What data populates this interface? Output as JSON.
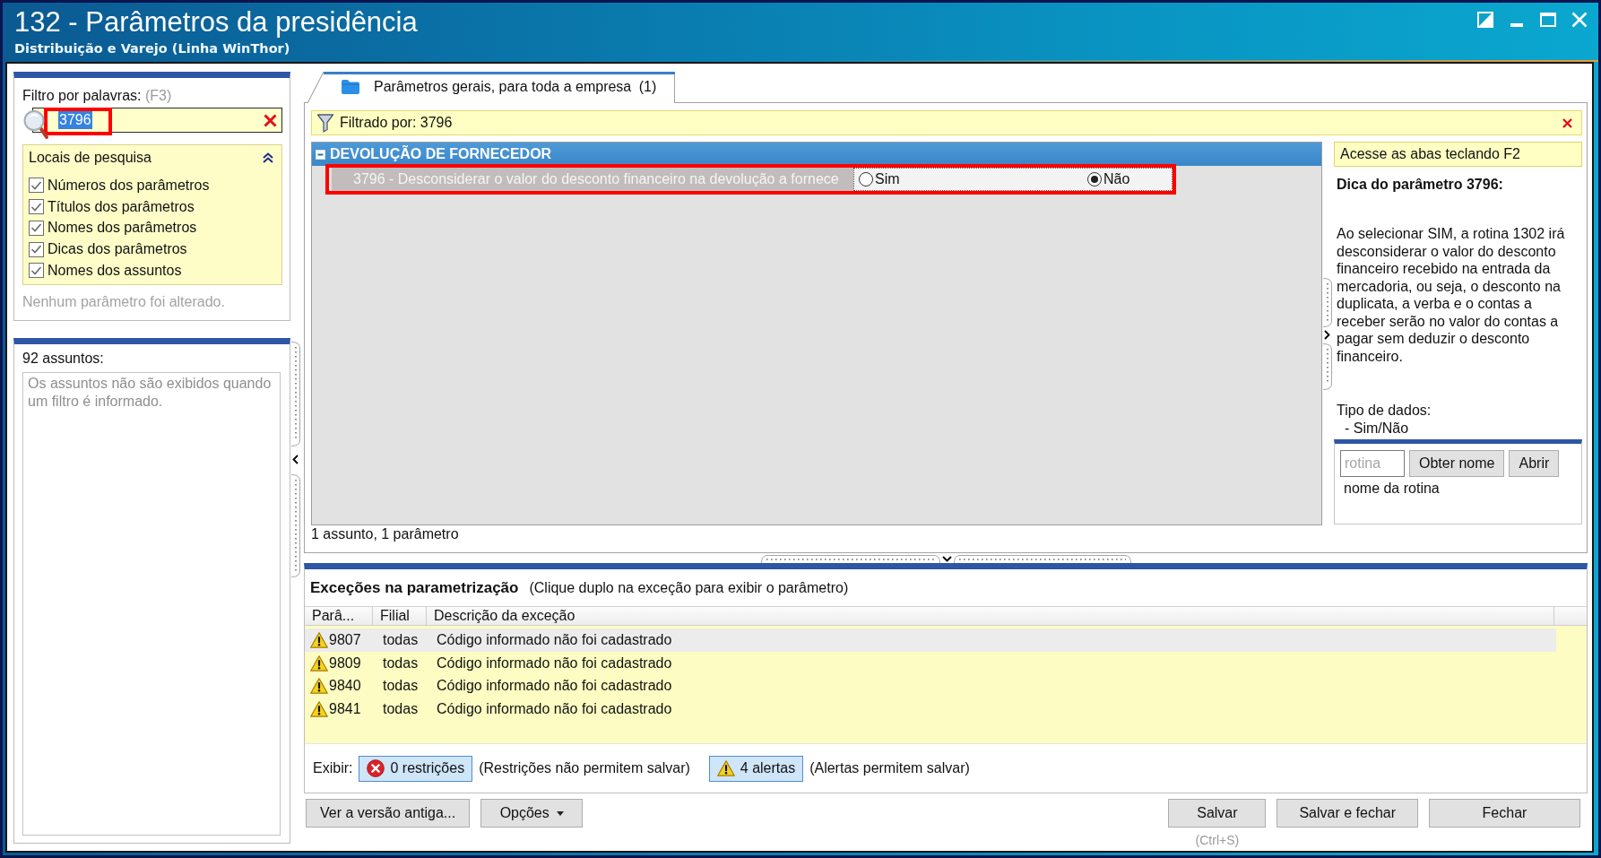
{
  "window": {
    "title": "132 - Parâmetros da presidência",
    "subtitle": "Distribuição e Varejo (Linha WinThor)"
  },
  "filter_panel": {
    "label": "Filtro por palavras:",
    "shortcut": "(F3)",
    "search": {
      "value": "3796",
      "text_selected": true,
      "highlighted": true
    },
    "search_locations": {
      "title": "Locais de pesquisa",
      "expanded": true,
      "options": [
        {
          "label": "Números dos parâmetros",
          "checked": true
        },
        {
          "label": "Títulos dos parâmetros",
          "checked": true
        },
        {
          "label": "Nomes dos parâmetros",
          "checked": true
        },
        {
          "label": "Dicas dos parâmetros",
          "checked": true
        },
        {
          "label": "Nomes dos assuntos",
          "checked": true
        }
      ]
    },
    "status": "Nenhum parâmetro foi alterado."
  },
  "subjects_panel": {
    "count": "92 assuntos:",
    "message": "Os assuntos não são exibidos quando um filtro é informado."
  },
  "tabs": [
    {
      "label": "Parâmetros gerais, para toda a empresa",
      "count": "(1)",
      "selected": true
    }
  ],
  "filter_bar": {
    "label": "Filtrado por: 3796"
  },
  "parameter_groups": [
    {
      "title": "DEVOLUÇÃO DE FORNECEDOR",
      "expanded": true,
      "parameters": [
        {
          "label": "3796 - Desconsiderar o valor do desconto financeiro na devolução a fornece",
          "highlighted": true,
          "options": [
            {
              "label": "Sim",
              "selected": false
            },
            {
              "label": "Não",
              "selected": true
            }
          ]
        }
      ]
    }
  ],
  "grid_status": "1 assunto, 1 parâmetro",
  "hint_panel": {
    "notice": "Acesse as abas teclando F2",
    "title": "Dica do parâmetro 3796:",
    "body": "Ao selecionar SIM, a rotina 1302 irá desconsiderar o valor do desconto financeiro recebido na entrada da mercadoria, ou seja, o desconto na duplicata, a verba e o contas a receber serão no valor do contas a pagar sem deduzir o desconto financeiro.",
    "data_type_label": "Tipo de dados:",
    "data_type": "- Sim/Não",
    "routine": {
      "placeholder": "rotina",
      "buttons": [
        "Obter nome",
        "Abrir"
      ],
      "name": "nome da rotina"
    }
  },
  "exceptions": {
    "title": "Exceções na parametrização",
    "hint": "(Clique duplo na exceção para exibir o parâmetro)",
    "columns": [
      "Parâ...",
      "Filial",
      "Descrição da exceção"
    ],
    "rows": [
      {
        "kind": "alert",
        "parameter": "9807",
        "branch": "todas",
        "description": "Código informado não foi cadastrado",
        "selected": true
      },
      {
        "kind": "alert",
        "parameter": "9809",
        "branch": "todas",
        "description": "Código informado não foi cadastrado",
        "selected": false
      },
      {
        "kind": "alert",
        "parameter": "9840",
        "branch": "todas",
        "description": "Código informado não foi cadastrado",
        "selected": false
      },
      {
        "kind": "alert",
        "parameter": "9841",
        "branch": "todas",
        "description": "Código informado não foi cadastrado",
        "selected": false
      }
    ],
    "show_label": "Exibir:",
    "filters": [
      {
        "kind": "restriction",
        "label": "0 restrições",
        "note": "(Restrições não permitem salvar)",
        "selected": true
      },
      {
        "kind": "alert",
        "label": "4 alertas",
        "note": "(Alertas permitem salvar)",
        "selected": true
      }
    ]
  },
  "footer": {
    "left_buttons": [
      {
        "label": "Ver a versão antiga...",
        "dropdown": false
      },
      {
        "label": "Opções",
        "dropdown": true
      }
    ],
    "right_buttons": [
      {
        "label": "Salvar",
        "shortcut": "(Ctrl+S)"
      },
      {
        "label": "Salvar e fechar"
      },
      {
        "label": "Fechar"
      }
    ]
  }
}
